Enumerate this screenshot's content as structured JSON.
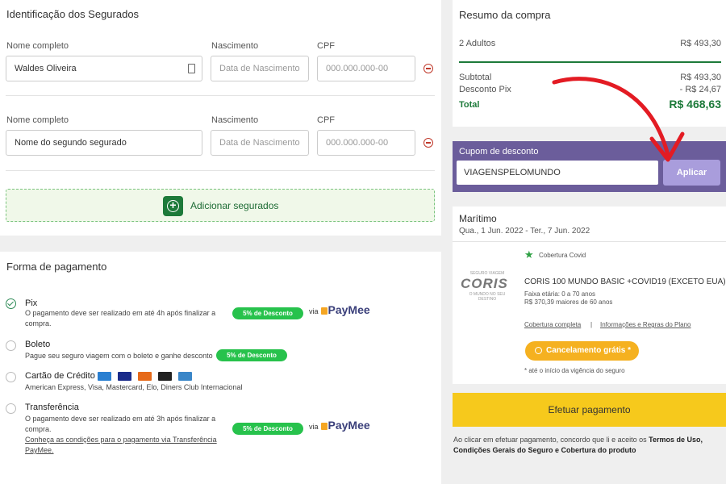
{
  "insured": {
    "title": "Identificação dos Segurados",
    "rows": [
      {
        "name_label": "Nome completo",
        "name_value": "Waldes Oliveira",
        "birth_label": "Nascimento",
        "birth_placeholder": "Data de Nascimento",
        "cpf_label": "CPF",
        "cpf_placeholder": "000.000.000-00"
      },
      {
        "name_label": "Nome completo",
        "name_placeholder": "Nome do segundo segurado",
        "birth_label": "Nascimento",
        "birth_placeholder": "Data de Nascimento",
        "cpf_label": "CPF",
        "cpf_placeholder": "000.000.000-00"
      }
    ],
    "add_label": "Adicionar segurados"
  },
  "payment": {
    "title": "Forma de pagamento",
    "pix": {
      "title": "Pix",
      "desc1": "O pagamento deve ser realizado em até 4h após finalizar a",
      "desc2": "compra.",
      "badge": "5% de Desconto",
      "via": "via",
      "brand": "PayMee"
    },
    "boleto": {
      "title": "Boleto",
      "desc": "Pague seu seguro viagem com o boleto e ganhe desconto",
      "badge": "5% de Desconto"
    },
    "card": {
      "title": "Cartão de Crédito",
      "desc": "American Express, Visa, Mastercard, Elo, Diners Club Internacional"
    },
    "transfer": {
      "title": "Transferência",
      "desc1": "O pagamento deve ser realizado em até 3h após finalizar a",
      "desc2": "compra.",
      "link1": "Conheça as condições para o pagamento via Transferência",
      "link2": "PayMee.",
      "badge": "5% de Desconto",
      "via": "via",
      "brand": "PayMee"
    },
    "selected": "pix"
  },
  "summary": {
    "title": "Resumo da compra",
    "adults_label": "2 Adultos",
    "adults_value": "R$ 493,30",
    "subtotal_label": "Subtotal",
    "subtotal_value": "R$ 493,30",
    "discount_label": "Desconto Pix",
    "discount_value": "- R$ 24,67",
    "total_label": "Total",
    "total_value": "R$ 468,63"
  },
  "coupon": {
    "title": "Cupom de desconto",
    "value": "VIAGENSPELOMUNDO",
    "apply_label": "Aplicar"
  },
  "plan": {
    "destination": "Marítimo",
    "dates": "Qua., 1 Jun. 2022 - Ter., 7 Jun. 2022",
    "covid": "Cobertura Covid",
    "logo": "CORIS",
    "logo_top": "SEGURO VIAGEM",
    "logo_bottom": "O MUNDO NO SEU DESTINO",
    "name": "CORIS 100 MUNDO BASIC +COVID19 (EXCETO EUA)",
    "age": "Faixa etária: 0 a 70 anos",
    "senior": "R$ 370,39 maiores de 60 anos",
    "link_coverage": "Cobertura completa",
    "separator": "|",
    "link_rules": "Informações e Regras do Plano",
    "cancel_label": "Cancelamento grátis *",
    "cancel_note": "* até o início da vigência do seguro"
  },
  "checkout": {
    "pay_label": "Efetuar pagamento",
    "terms_prefix": "Ao clicar em efetuar pagamento, concordo que li e aceito os",
    "terms_bold1": "Termos de Uso,",
    "terms_bold2": "Condições Gerais do Seguro e Cobertura do produto"
  },
  "colors": {
    "accent_green": "#1d7a3a",
    "coupon_bg": "#6b5d9b",
    "pay_yellow": "#f6c91c",
    "arrow_red": "#e31b23"
  }
}
